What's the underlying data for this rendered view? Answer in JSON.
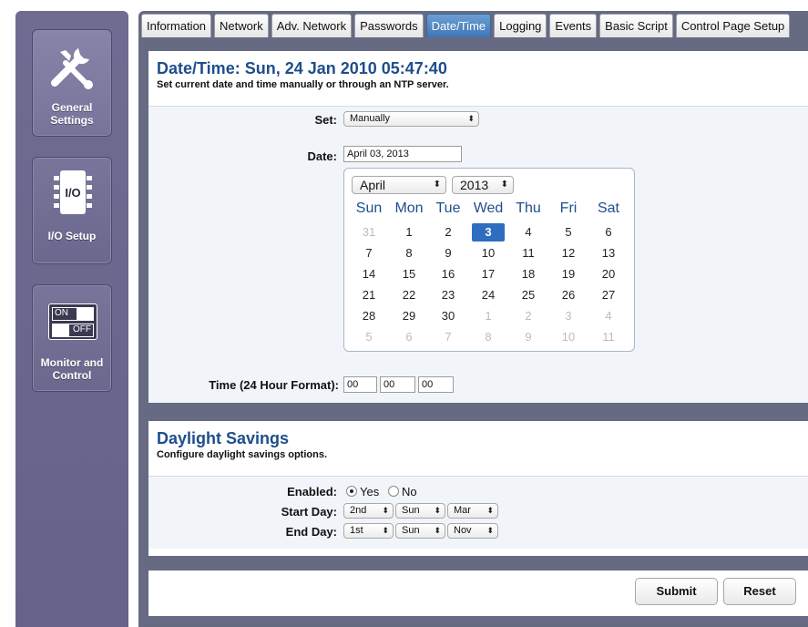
{
  "sidebar": {
    "items": [
      {
        "label_line1": "General",
        "label_line2": "Settings"
      },
      {
        "label_line1": "I/O Setup",
        "icon_text": "I/O"
      },
      {
        "label_line1": "Monitor and",
        "label_line2": "Control",
        "on_text": "ON",
        "off_text": "OFF"
      }
    ]
  },
  "tabs": [
    "Information",
    "Network",
    "Adv. Network",
    "Passwords",
    "Date/Time",
    "Logging",
    "Events",
    "Basic Script",
    "Control Page Setup"
  ],
  "active_tab": "Date/Time",
  "datetime": {
    "title": "Date/Time: Sun, 24 Jan 2010 05:47:40",
    "subtitle": "Set current date and time manually or through an NTP server.",
    "set_label": "Set:",
    "set_value": "Manually",
    "date_label": "Date:",
    "date_value": "April 03, 2013",
    "time_label": "Time (24 Hour Format):",
    "time_hh": "00",
    "time_mm": "00",
    "time_ss": "00"
  },
  "calendar": {
    "month": "April",
    "year": "2013",
    "weekdays": [
      "Sun",
      "Mon",
      "Tue",
      "Wed",
      "Thu",
      "Fri",
      "Sat"
    ],
    "weeks": [
      [
        "31",
        "1",
        "2",
        "3",
        "4",
        "5",
        "6"
      ],
      [
        "7",
        "8",
        "9",
        "10",
        "11",
        "12",
        "13"
      ],
      [
        "14",
        "15",
        "16",
        "17",
        "18",
        "19",
        "20"
      ],
      [
        "21",
        "22",
        "23",
        "24",
        "25",
        "26",
        "27"
      ],
      [
        "28",
        "29",
        "30",
        "1",
        "2",
        "3",
        "4"
      ],
      [
        "5",
        "6",
        "7",
        "8",
        "9",
        "10",
        "11"
      ]
    ],
    "selected": "3"
  },
  "daylight": {
    "title": "Daylight Savings",
    "subtitle": "Configure daylight savings options.",
    "enabled_label": "Enabled:",
    "yes": "Yes",
    "no": "No",
    "enabled": "Yes",
    "start_label": "Start Day:",
    "start": [
      "2nd",
      "Sun",
      "Mar"
    ],
    "end_label": "End Day:",
    "end": [
      "1st",
      "Sun",
      "Nov"
    ]
  },
  "actions": {
    "submit": "Submit",
    "reset": "Reset"
  },
  "colors": {
    "accent": "#1f4e8c",
    "sidebar": "#6b6890",
    "selected_day": "#2e6ec1"
  }
}
